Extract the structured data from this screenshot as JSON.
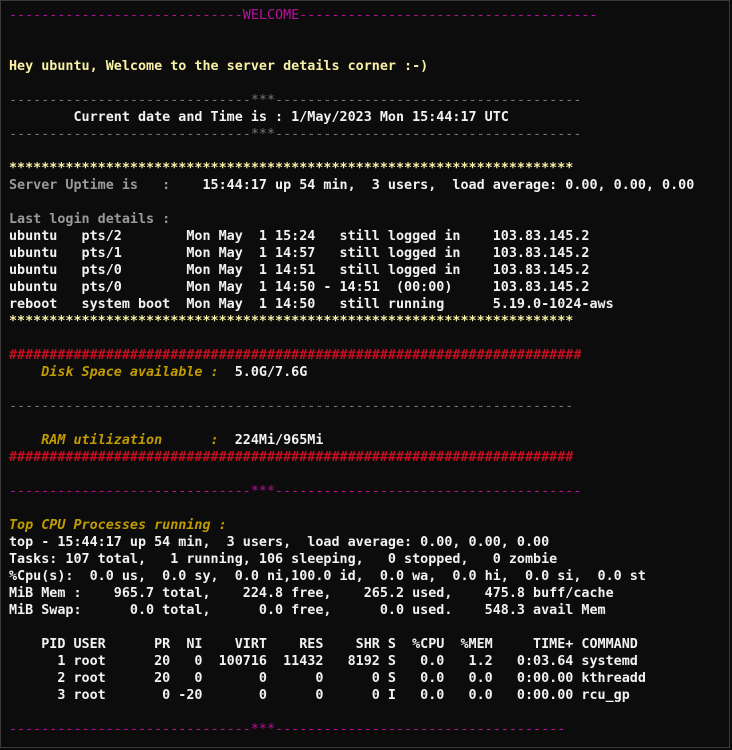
{
  "terminal": {
    "lines": [
      {
        "t": "-----------------------------WELCOME-------------------------------------",
        "c": "purple"
      },
      {
        "t": "",
        "c": ""
      },
      {
        "t": "",
        "c": ""
      },
      {
        "t": "Hey ubuntu, Welcome to the server details corner :-)",
        "c": "yellow bold"
      },
      {
        "t": "",
        "c": ""
      },
      {
        "t": "------------------------------***--------------------------------------",
        "c": "gray"
      },
      {
        "t": "        Current date and Time is : 1/May/2023 Mon 15:44:17 UTC",
        "c": "white bold"
      },
      {
        "t": "------------------------------***--------------------------------------",
        "c": "gray"
      },
      {
        "t": "",
        "c": ""
      },
      {
        "t": "**********************************************************************",
        "c": "yellow bold"
      },
      {
        "t": "Server Uptime is   :    15:44:17 up 54 min,  3 users,  load average: 0.00, 0.00, 0.00",
        "c": "bgray bold",
        "hl": 20,
        "hc": "white bold"
      },
      {
        "t": "",
        "c": ""
      },
      {
        "t": "Last login details :",
        "c": "bgray bold"
      },
      {
        "t": "ubuntu   pts/2        Mon May  1 15:24   still logged in    103.83.145.2",
        "c": "white bold"
      },
      {
        "t": "ubuntu   pts/1        Mon May  1 14:57   still logged in    103.83.145.2",
        "c": "white bold"
      },
      {
        "t": "ubuntu   pts/0        Mon May  1 14:51   still logged in    103.83.145.2",
        "c": "white bold"
      },
      {
        "t": "ubuntu   pts/0        Mon May  1 14:50 - 14:51  (00:00)     103.83.145.2",
        "c": "white bold"
      },
      {
        "t": "reboot   system boot  Mon May  1 14:50   still running      5.19.0-1024-aws",
        "c": "white bold"
      },
      {
        "t": "**********************************************************************",
        "c": "yellow bold"
      },
      {
        "t": "",
        "c": ""
      },
      {
        "t": "#######################################################################",
        "c": "red bold"
      },
      {
        "t": "    Disk Space available :  5.0G/7.6G",
        "c": "gold bold italic",
        "hl": 27,
        "hc": "white bold"
      },
      {
        "t": "",
        "c": ""
      },
      {
        "t": "----------------------------------------------------------------------",
        "c": "gray"
      },
      {
        "t": "",
        "c": ""
      },
      {
        "t": "    RAM utilization      :  224Mi/965Mi",
        "c": "gold bold italic",
        "hl": 27,
        "hc": "white bold"
      },
      {
        "t": "######################################################################",
        "c": "red bold"
      },
      {
        "t": "",
        "c": ""
      },
      {
        "t": "------------------------------***--------------------------------------",
        "c": "purple"
      },
      {
        "t": "",
        "c": ""
      },
      {
        "t": "Top CPU Processes running :",
        "c": "gold bold italic"
      },
      {
        "t": "top - 15:44:17 up 54 min,  3 users,  load average: 0.00, 0.00, 0.00",
        "c": "white bold"
      },
      {
        "t": "Tasks: 107 total,   1 running, 106 sleeping,   0 stopped,   0 zombie",
        "c": "white bold"
      },
      {
        "t": "%Cpu(s):  0.0 us,  0.0 sy,  0.0 ni,100.0 id,  0.0 wa,  0.0 hi,  0.0 si,  0.0 st",
        "c": "white bold"
      },
      {
        "t": "MiB Mem :    965.7 total,    224.8 free,    265.2 used,    475.8 buff/cache",
        "c": "white bold"
      },
      {
        "t": "MiB Swap:      0.0 total,      0.0 free,      0.0 used.    548.3 avail Mem",
        "c": "white bold"
      },
      {
        "t": "",
        "c": ""
      },
      {
        "t": "    PID USER      PR  NI    VIRT    RES    SHR S  %CPU  %MEM     TIME+ COMMAND",
        "c": "white bold"
      },
      {
        "t": "      1 root      20   0  100716  11432   8192 S   0.0   1.2   0:03.64 systemd",
        "c": "white bold"
      },
      {
        "t": "      2 root      20   0       0      0      0 S   0.0   0.0   0:00.00 kthreadd",
        "c": "white bold"
      },
      {
        "t": "      3 root       0 -20       0      0      0 I   0.0   0.0   0:00.00 rcu_gp",
        "c": "white bold"
      },
      {
        "t": "",
        "c": ""
      },
      {
        "t": "------------------------------***------------------------------------",
        "c": "purple"
      }
    ]
  }
}
